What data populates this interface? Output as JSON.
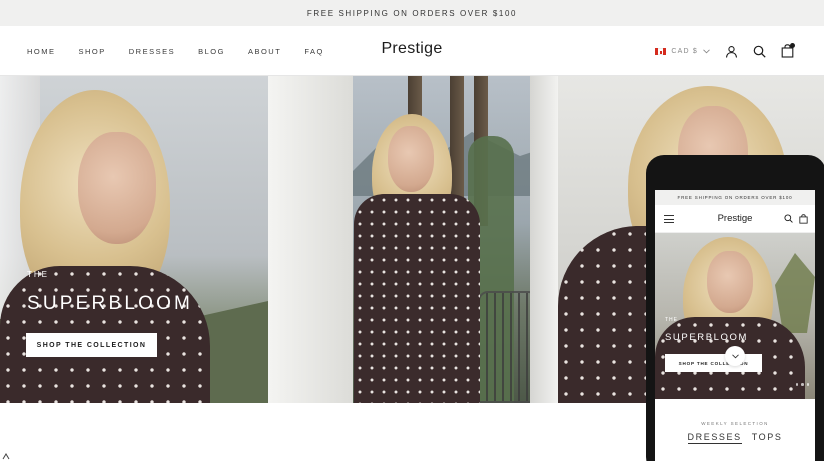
{
  "announcement": {
    "text": "FREE SHIPPING ON ORDERS OVER $100"
  },
  "header": {
    "nav": [
      {
        "label": "HOME"
      },
      {
        "label": "SHOP"
      },
      {
        "label": "DRESSES"
      },
      {
        "label": "BLOG"
      },
      {
        "label": "ABOUT"
      },
      {
        "label": "FAQ"
      }
    ],
    "logo": "Prestige",
    "currency": {
      "label": "CAD $",
      "flag_icon": "canada-flag-icon"
    },
    "icons": [
      "account-icon",
      "search-icon",
      "cart-icon"
    ]
  },
  "hero": {
    "eyebrow": "THE",
    "title": "SUPERBLOOM",
    "cta_label": "SHOP THE COLLECTION"
  },
  "mobile": {
    "announcement": "FREE SHIPPING ON ORDERS OVER $100",
    "logo": "Prestige",
    "hero": {
      "eyebrow": "THE",
      "title": "SUPERBLOOM",
      "cta_label": "SHOP THE COLLECTION"
    },
    "section_eyebrow": "WEEKLY SELECTION",
    "tabs": [
      {
        "label": "DRESSES"
      },
      {
        "label": "TOPS"
      }
    ]
  },
  "colors": {
    "announcement_bg": "#f0f0ef",
    "text_dark": "#1c1c1c",
    "dress": "#3a2a2b",
    "flag_red": "#d52b1e"
  }
}
